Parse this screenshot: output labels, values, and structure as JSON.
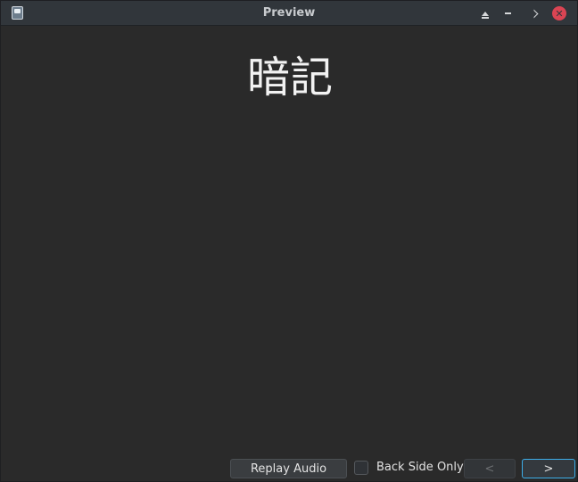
{
  "window": {
    "title": "Preview"
  },
  "titlebar": {
    "icons": [
      "app-icon",
      "keep-above-icon",
      "minimize-icon",
      "maximize-icon",
      "close-icon"
    ]
  },
  "card": {
    "front_text": "暗記"
  },
  "controls": {
    "replay_label": "Replay Audio",
    "back_side_only_label": "Back Side Only",
    "back_side_only_checked": false,
    "prev_label": "<",
    "next_label": ">",
    "prev_enabled": false,
    "next_enabled": true
  },
  "colors": {
    "background": "#2a2a2a",
    "titlebar": "#31363b",
    "close": "#da4453",
    "focus": "#3daee9"
  }
}
